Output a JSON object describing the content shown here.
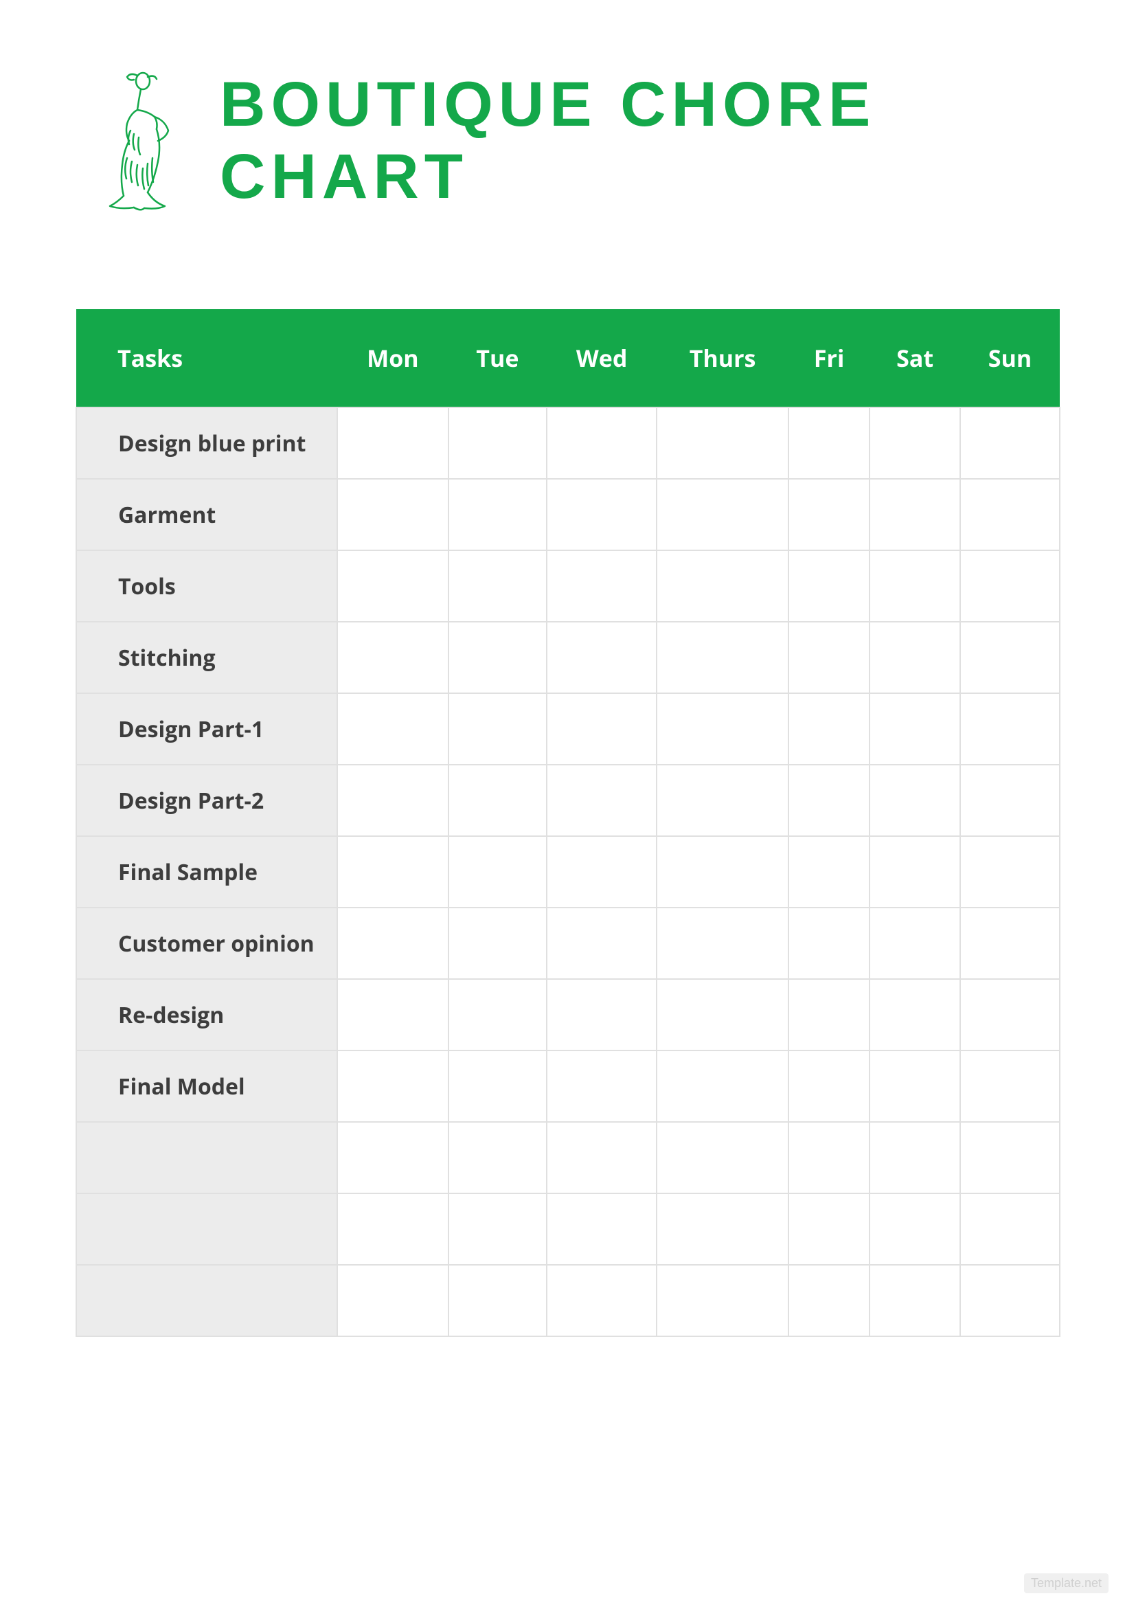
{
  "header": {
    "title": "BOUTIQUE CHORE CHART",
    "icon": "fashion-figure-icon"
  },
  "colors": {
    "accent": "#14a84a"
  },
  "table": {
    "headers": [
      "Tasks",
      "Mon",
      "Tue",
      "Wed",
      "Thurs",
      "Fri",
      "Sat",
      "Sun"
    ],
    "rows": [
      {
        "task": "Design blue print",
        "cells": [
          "",
          "",
          "",
          "",
          "",
          "",
          ""
        ]
      },
      {
        "task": "Garment",
        "cells": [
          "",
          "",
          "",
          "",
          "",
          "",
          ""
        ]
      },
      {
        "task": "Tools",
        "cells": [
          "",
          "",
          "",
          "",
          "",
          "",
          ""
        ]
      },
      {
        "task": "Stitching",
        "cells": [
          "",
          "",
          "",
          "",
          "",
          "",
          ""
        ]
      },
      {
        "task": "Design Part-1",
        "cells": [
          "",
          "",
          "",
          "",
          "",
          "",
          ""
        ]
      },
      {
        "task": "Design Part-2",
        "cells": [
          "",
          "",
          "",
          "",
          "",
          "",
          ""
        ]
      },
      {
        "task": "Final Sample",
        "cells": [
          "",
          "",
          "",
          "",
          "",
          "",
          ""
        ]
      },
      {
        "task": "Customer opinion",
        "cells": [
          "",
          "",
          "",
          "",
          "",
          "",
          ""
        ]
      },
      {
        "task": "Re-design",
        "cells": [
          "",
          "",
          "",
          "",
          "",
          "",
          ""
        ]
      },
      {
        "task": "Final Model",
        "cells": [
          "",
          "",
          "",
          "",
          "",
          "",
          ""
        ]
      },
      {
        "task": "",
        "cells": [
          "",
          "",
          "",
          "",
          "",
          "",
          ""
        ]
      },
      {
        "task": "",
        "cells": [
          "",
          "",
          "",
          "",
          "",
          "",
          ""
        ]
      },
      {
        "task": "",
        "cells": [
          "",
          "",
          "",
          "",
          "",
          "",
          ""
        ]
      }
    ]
  },
  "watermark": "Template.net"
}
